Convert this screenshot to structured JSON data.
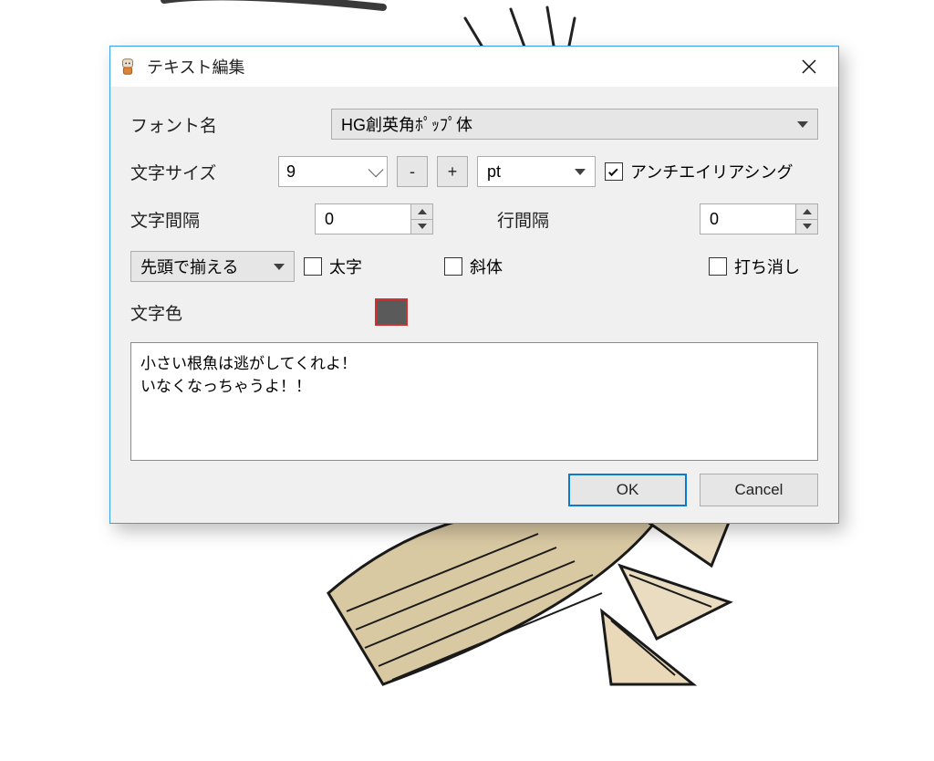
{
  "dialog": {
    "title": "テキスト編集",
    "labels": {
      "font_name": "フォント名",
      "font_size": "文字サイズ",
      "char_spacing": "文字間隔",
      "line_spacing": "行間隔",
      "bold": "太字",
      "italic": "斜体",
      "strikethrough": "打ち消し",
      "text_color": "文字色",
      "antialias": "アンチエイリアシング"
    },
    "values": {
      "font_name": "HG創英角ﾎﾟｯﾌﾟ体",
      "font_size": "9",
      "minus": "-",
      "plus": "+",
      "unit": "pt",
      "char_spacing": "0",
      "line_spacing": "0",
      "alignment": "先頭で揃える",
      "text_content": "小さい根魚は逃がしてくれよ！\nいなくなっちゃうよ！！",
      "text_color_hex": "#5a5a5a"
    },
    "checks": {
      "antialias": true,
      "bold": false,
      "italic": false,
      "strikethrough": false
    },
    "buttons": {
      "ok": "OK",
      "cancel": "Cancel"
    }
  }
}
